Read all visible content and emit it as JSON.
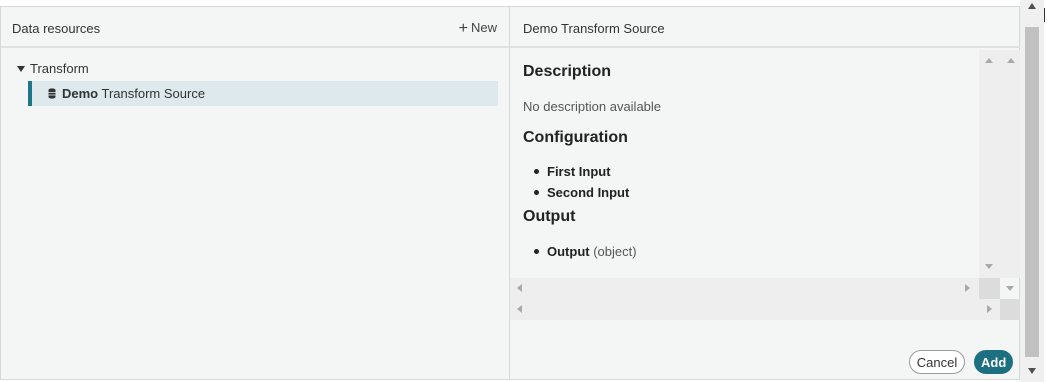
{
  "left_pane": {
    "title": "Data resources",
    "new_label": "New",
    "tree": {
      "group_label": "Transform",
      "items": [
        {
          "bold": "Demo",
          "rest": " Transform Source",
          "selected": true,
          "icon": "database-icon"
        }
      ]
    }
  },
  "right_pane": {
    "title": "Demo Transform Source",
    "description_heading": "Description",
    "description_text": "No description available",
    "configuration_heading": "Configuration",
    "configuration_items": [
      "First Input",
      "Second Input"
    ],
    "output_heading": "Output",
    "output_items": [
      {
        "name": "Output",
        "type": "(object)"
      }
    ]
  },
  "footer": {
    "cancel_label": "Cancel",
    "add_label": "Add"
  },
  "colors": {
    "accent": "#1d6f82",
    "selected_row_bg": "#dde9ec",
    "panel_bg": "#f4f6f5"
  }
}
